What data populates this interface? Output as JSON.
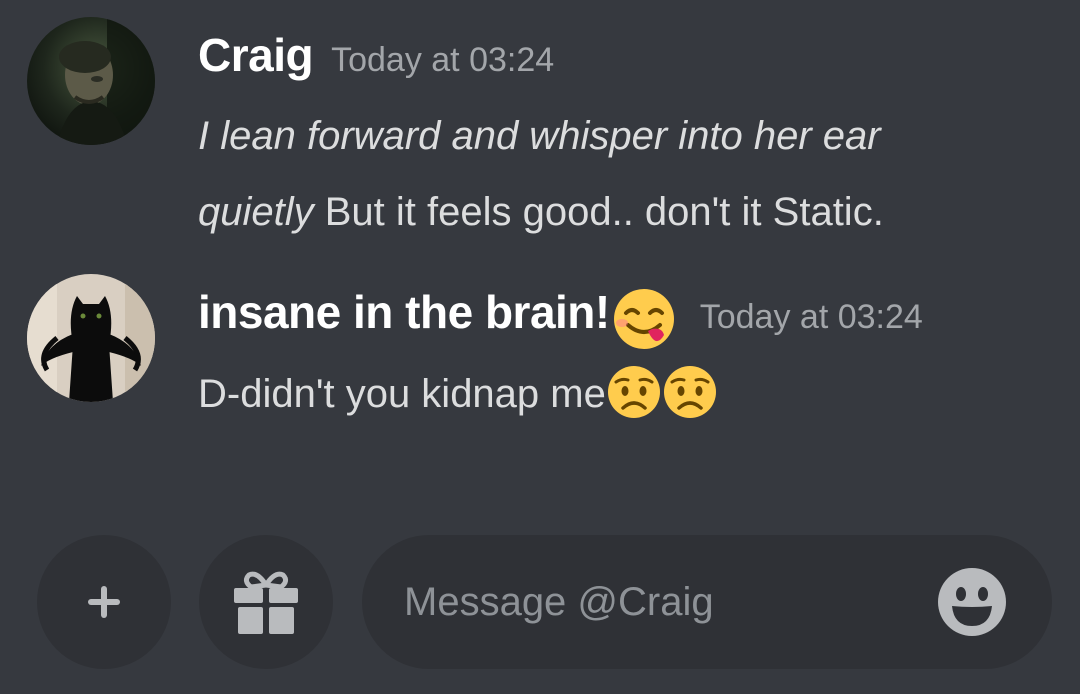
{
  "messages": [
    {
      "author": "Craig",
      "timestamp": "Today at 03:24",
      "avatar": "dark-portrait-avatar",
      "action_line1": "I lean forward and whisper into her ear",
      "action_line2": "quietly",
      "text": " But it feels good.. don't it Static."
    },
    {
      "author": "insane in the brain!",
      "author_emoji": "face-savoring-food-emoji",
      "timestamp": "Today at 03:24",
      "avatar": "black-cat-avatar",
      "text": "D-didn't you kidnap me",
      "trailing_emojis": [
        "worried-face-emoji",
        "worried-face-emoji"
      ]
    }
  ],
  "composer": {
    "add_icon": "plus-icon",
    "gift_icon": "gift-icon",
    "placeholder": "Message @Craig",
    "emoji_icon": "smile-icon"
  },
  "colors": {
    "background": "#36393f",
    "input_background": "#2f3136",
    "username": "#ffffff",
    "text": "#dcddde",
    "timestamp": "#a3a6aa",
    "placeholder": "#8e9297",
    "emoji_yellow": "#ffcc4d"
  }
}
